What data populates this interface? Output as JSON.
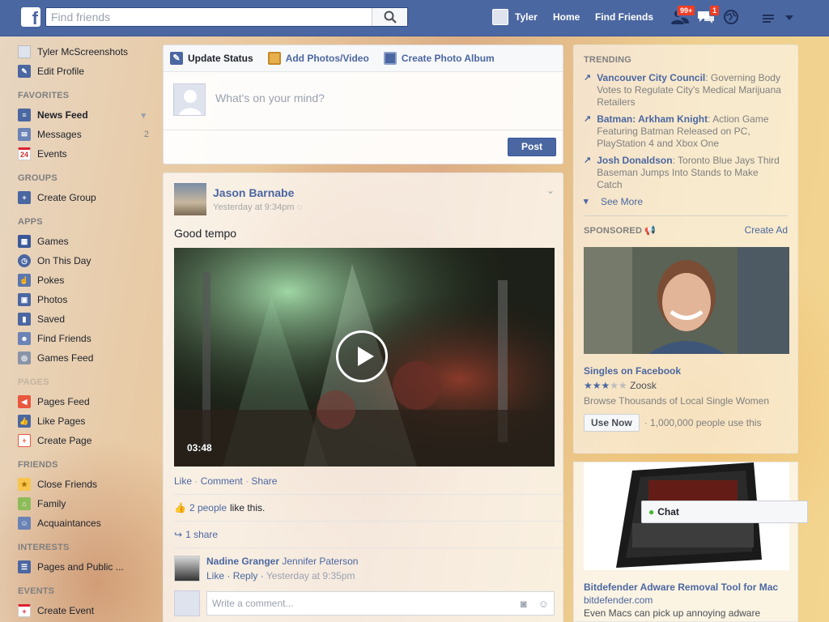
{
  "topbar": {
    "logo": "f",
    "search_placeholder": "Find friends",
    "user_name": "Tyler",
    "home": "Home",
    "find_friends": "Find Friends",
    "friend_requests_badge": "99+",
    "messages_badge": "1"
  },
  "leftnav": {
    "profile_name": "Tyler McScreenshots",
    "edit_profile": "Edit Profile",
    "favorites_heading": "FAVORITES",
    "news_feed": "News Feed",
    "messages": "Messages",
    "messages_count": "2",
    "events": "Events",
    "events_icon_date": "24",
    "groups_heading": "GROUPS",
    "create_group": "Create Group",
    "apps_heading": "APPS",
    "games": "Games",
    "on_this_day": "On This Day",
    "pokes": "Pokes",
    "photos": "Photos",
    "saved": "Saved",
    "find_friends": "Find Friends",
    "games_feed": "Games Feed",
    "pages_heading": "PAGES",
    "pages_feed": "Pages Feed",
    "like_pages": "Like Pages",
    "create_page": "Create Page",
    "friends_heading": "FRIENDS",
    "close_friends": "Close Friends",
    "family": "Family",
    "acquaintances": "Acquaintances",
    "interests_heading": "INTERESTS",
    "pages_and_public": "Pages and Public ...",
    "events_heading": "EVENTS",
    "create_event": "Create Event"
  },
  "composer": {
    "tab_update_status": "Update Status",
    "tab_add_photos": "Add Photos/Video",
    "tab_create_album": "Create Photo Album",
    "placeholder": "What's on your mind?",
    "post_button": "Post"
  },
  "story": {
    "author": "Jason Barnabe",
    "timestamp": "Yesterday at 9:34pm",
    "text": "Good tempo",
    "video_duration": "03:48",
    "actions": {
      "like": "Like",
      "comment": "Comment",
      "share": "Share"
    },
    "likes_link": "2 people",
    "likes_suffix": "like this.",
    "shares": "1 share",
    "comment": {
      "author": "Nadine Granger",
      "text": "Jennifer Paterson",
      "like": "Like",
      "reply": "Reply",
      "time": "Yesterday at 9:35pm"
    },
    "write_comment_placeholder": "Write a comment..."
  },
  "trending": {
    "heading": "TRENDING",
    "items": [
      {
        "title": "Vancouver City Council",
        "desc": ": Governing Body Votes to Regulate City's Medical Marijuana Retailers"
      },
      {
        "title": "Batman: Arkham Knight",
        "desc": ": Action Game Featuring Batman Released on PC, PlayStation 4 and Xbox One"
      },
      {
        "title": "Josh Donaldson",
        "desc": ": Toronto Blue Jays Third Baseman Jumps Into Stands to Make Catch"
      }
    ],
    "see_more": "See More"
  },
  "sponsored": {
    "heading": "SPONSORED",
    "create_ad": "Create Ad",
    "ad1": {
      "title": "Singles on Facebook",
      "rating": 2.5,
      "advertiser": "Zoosk",
      "desc": "Browse Thousands of Local Single Women",
      "cta": "Use Now",
      "users": "· 1,000,000 people use this"
    },
    "ad2": {
      "title": "Bitdefender Adware Removal Tool for Mac",
      "domain": "bitdefender.com",
      "desc": "Even Macs can pick up annoying adware"
    }
  },
  "chat": {
    "label": "Chat"
  },
  "colors": {
    "brand": "#4b67a1",
    "badge": "#f03d25"
  }
}
